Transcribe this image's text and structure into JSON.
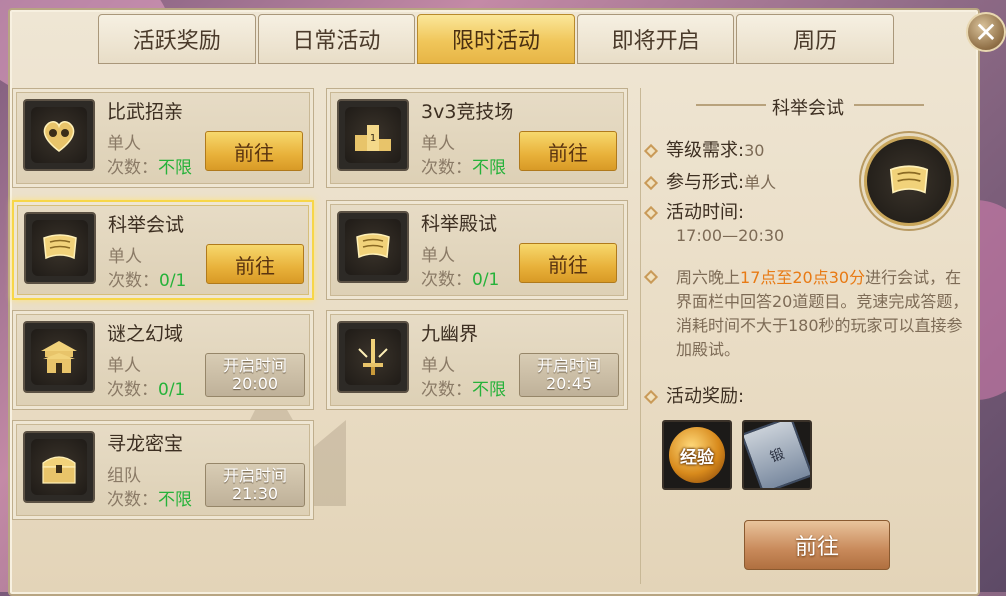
{
  "tabs": [
    {
      "label": "活跃奖励",
      "active": false
    },
    {
      "label": "日常活动",
      "active": false
    },
    {
      "label": "限时活动",
      "active": true
    },
    {
      "label": "即将开启",
      "active": false
    },
    {
      "label": "周历",
      "active": false
    }
  ],
  "close_icon": "✕",
  "activities": [
    {
      "name": "比武招亲",
      "mode": "单人",
      "count_label": "次数：",
      "count": "不限",
      "action": "前往",
      "icon": "heart-couple-icon"
    },
    {
      "name": "3v3竞技场",
      "mode": "单人",
      "count_label": "次数：",
      "count": "不限",
      "action": "前往",
      "icon": "podium-icon"
    },
    {
      "name": "科举会试",
      "mode": "单人",
      "count_label": "次数：",
      "count": "0/1",
      "action": "前往",
      "icon": "scroll-icon",
      "selected": true
    },
    {
      "name": "科举殿试",
      "mode": "单人",
      "count_label": "次数：",
      "count": "0/1",
      "action": "前往",
      "icon": "scroll-icon"
    },
    {
      "name": "谜之幻域",
      "mode": "单人",
      "count_label": "次数：",
      "count": "0/1",
      "open_label": "开启时间",
      "open_time": "20:00",
      "icon": "palace-icon"
    },
    {
      "name": "九幽界",
      "mode": "单人",
      "count_label": "次数：",
      "count": "不限",
      "open_label": "开启时间",
      "open_time": "20:45",
      "icon": "sword-icon"
    },
    {
      "name": "寻龙密宝",
      "mode": "组队",
      "count_label": "次数：",
      "count": "不限",
      "open_label": "开启时间",
      "open_time": "21:30",
      "icon": "treasure-chest-icon"
    }
  ],
  "detail": {
    "title": "科举会试",
    "level_label": "等级需求:",
    "level_value": "30",
    "mode_label": "参与形式:",
    "mode_value": "单人",
    "time_label": "活动时间:",
    "time_value": "17:00—20:30",
    "desc_pre": "周六晚上",
    "desc_highlight": "17点至20点30分",
    "desc_post": "进行会试，在界面栏中回答20道题目。竞速完成答题，消耗时间不大于180秒的玩家可以直接参加殿试。",
    "reward_label": "活动奖励:",
    "rewards": [
      {
        "label": "经验",
        "icon": "exp-orb-icon"
      },
      {
        "label": "锻",
        "icon": "forge-scroll-icon"
      }
    ],
    "go_label": "前往"
  },
  "colors": {
    "active_tab": "#f0c65a",
    "count_green": "#26b23a",
    "highlight_orange": "#e87a14",
    "go_button": "#e8b13a"
  }
}
